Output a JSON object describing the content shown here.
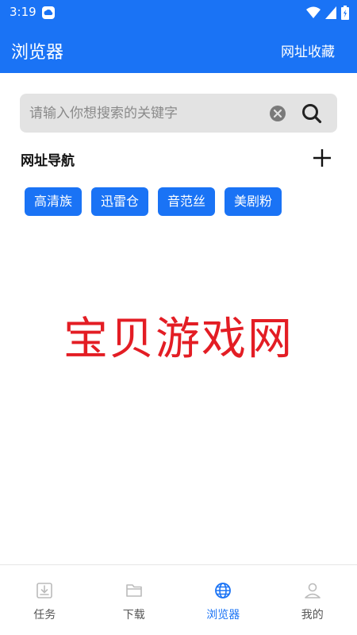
{
  "status_bar": {
    "time": "3:19"
  },
  "app_bar": {
    "title": "浏览器",
    "action_label": "网址收藏"
  },
  "search": {
    "placeholder": "请输入你想搜索的关键字"
  },
  "section": {
    "title": "网址导航"
  },
  "chips": [
    "高清族",
    "迅雷仓",
    "音范丝",
    "美剧粉"
  ],
  "watermark": "宝贝游戏网",
  "bottom_nav": {
    "items": [
      {
        "label": "任务",
        "icon": "download-tray-icon",
        "active": false
      },
      {
        "label": "下载",
        "icon": "folder-icon",
        "active": false
      },
      {
        "label": "浏览器",
        "icon": "globe-icon",
        "active": true
      },
      {
        "label": "我的",
        "icon": "person-icon",
        "active": false
      }
    ]
  },
  "colors": {
    "primary": "#1a73f5",
    "watermark": "#e31d24"
  }
}
